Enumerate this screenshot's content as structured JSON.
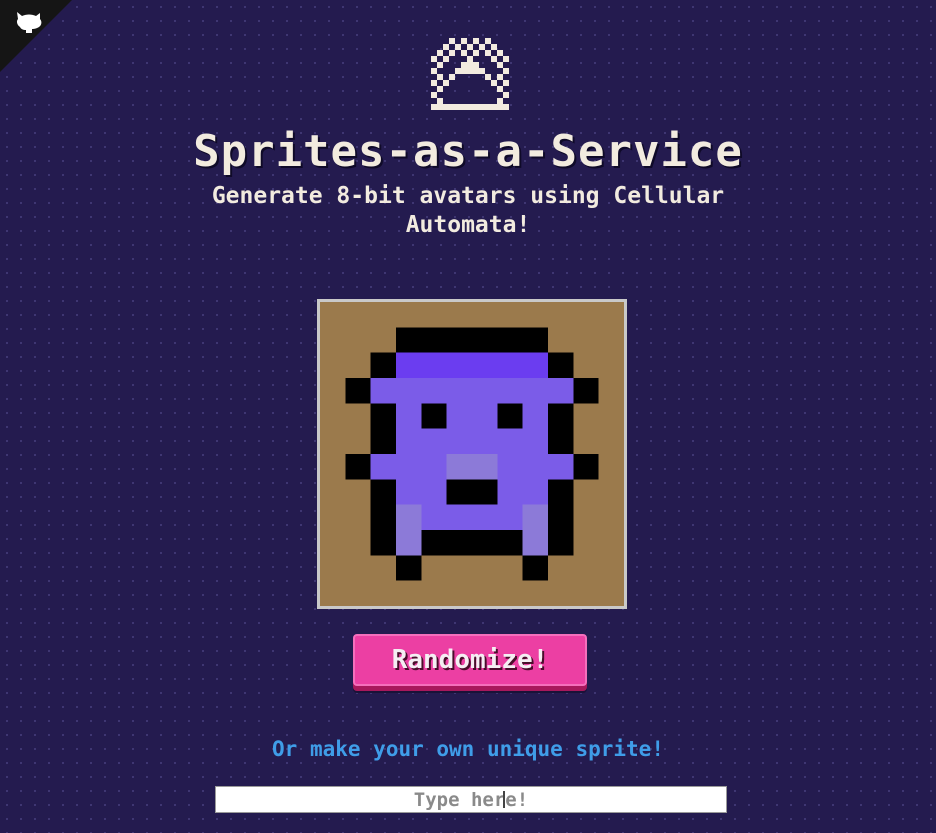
{
  "header": {
    "corner_icon": "github-octocat-icon",
    "logo_icon": "pixel-sprite-logo-icon",
    "title": "Sprites-as-a-Service",
    "subtitle_line1": "Generate 8-bit avatars using Cellular",
    "subtitle_line2": "Automata!"
  },
  "sprite": {
    "background_color": "#9b7a4c",
    "border_color": "#c9c9c9",
    "body_color": "#7b5ce8",
    "highlight_color": "#6b3df0",
    "outline_color": "#000000",
    "grid_size": 12,
    "rows": [
      "............",
      "...######...",
      "..#HHHHHH#..",
      ".#BBBBBBBB#.",
      "..#B#BB#B#..",
      "..#BBBBBB#..",
      ".#BBBSSBBB#.",
      "..#BB##BB#..",
      "..#SBBBBS#..",
      "..#S####S#..",
      "...#....#...",
      "............"
    ]
  },
  "actions": {
    "randomize_label": "Randomize!"
  },
  "custom": {
    "cta_text": "Or make your own unique sprite!",
    "input_placeholder": "Type here!",
    "input_value": ""
  }
}
